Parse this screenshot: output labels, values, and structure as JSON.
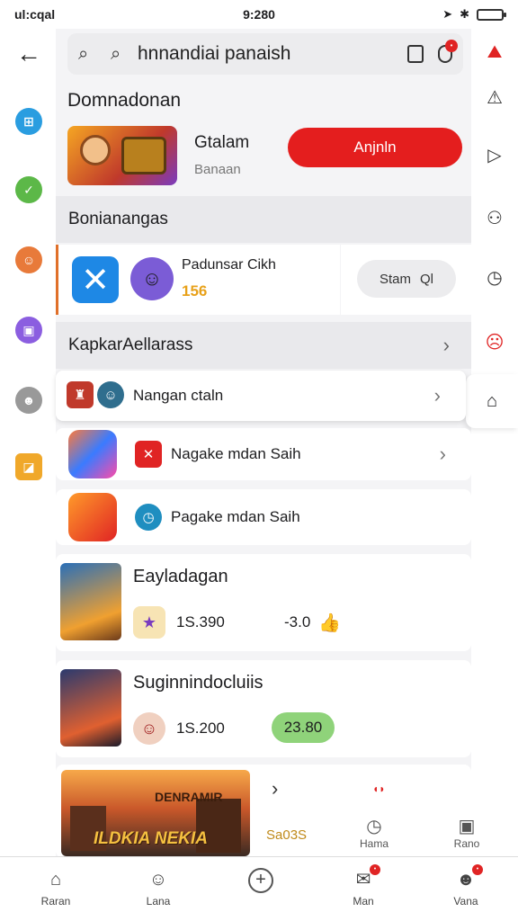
{
  "status_bar": {
    "carrier": "ul:cqal",
    "time": "9:280",
    "battery_level": 0.9
  },
  "search": {
    "query": "hnnandiai panaish"
  },
  "featured": {
    "section_title": "Domnadonan",
    "title": "Gtalam",
    "subtitle": "Banaan",
    "button_label": "Anjnln"
  },
  "sections": {
    "s1": "Bonianangas",
    "s2": "KapkarAellarass"
  },
  "promo": {
    "title": "Padunsar Cikh",
    "value": "156",
    "button_label": "Stam",
    "button_suffix": "Ql"
  },
  "list_rows": [
    {
      "label": "Nangan ctaln"
    },
    {
      "label": "Nagake mdan Saih"
    },
    {
      "label": "Pagake mdan Saih"
    }
  ],
  "games": [
    {
      "title": "Eayladagan",
      "stat_left": "1S.390",
      "stat_right": "-3.0"
    },
    {
      "title": "Suginnindocluiis",
      "stat_left": "1S.200",
      "stat_right": "23.80"
    }
  ],
  "banner": {
    "line1": "DENRAMIR",
    "line2": "ILDKIA NEKIA"
  },
  "sub_tabs": [
    {
      "label": "Sa03S"
    },
    {
      "label": "Hama"
    },
    {
      "label": "Rano"
    }
  ],
  "bottom_nav": [
    {
      "label": "Raran"
    },
    {
      "label": "Lana"
    },
    {
      "label": ""
    },
    {
      "label": "Man"
    },
    {
      "label": "Vana"
    }
  ],
  "colors": {
    "accent_red": "#e41e1e",
    "promo_value": "#e8a11a",
    "green_pill": "#8fd37a"
  }
}
